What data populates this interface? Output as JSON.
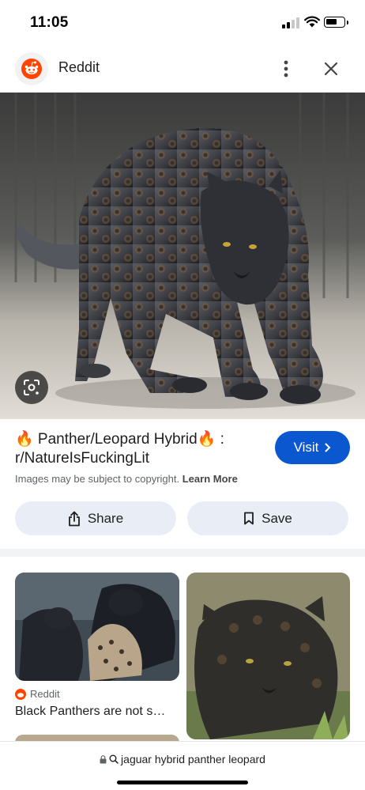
{
  "status_bar": {
    "time": "11:05"
  },
  "header": {
    "site_name": "Reddit",
    "logo_icon": "reddit-logo-icon",
    "more_icon": "more-vert-icon",
    "close_icon": "close-icon"
  },
  "result": {
    "title": "🔥 Panther/Leopard Hybrid🔥 : r/NatureIsFuckingLit",
    "visit_label": "Visit",
    "copyright_text": "Images may be subject to copyright.",
    "learn_more_label": "Learn More",
    "share_label": "Share",
    "save_label": "Save"
  },
  "related": [
    {
      "source": "Reddit",
      "caption": "Black Panthers are not s…"
    }
  ],
  "bottom_bar": {
    "url": "jaguar hybrid panther leopard"
  },
  "colors": {
    "accent": "#0b57d0",
    "button_bg": "#e9eef6",
    "reddit": "#ff4500"
  }
}
